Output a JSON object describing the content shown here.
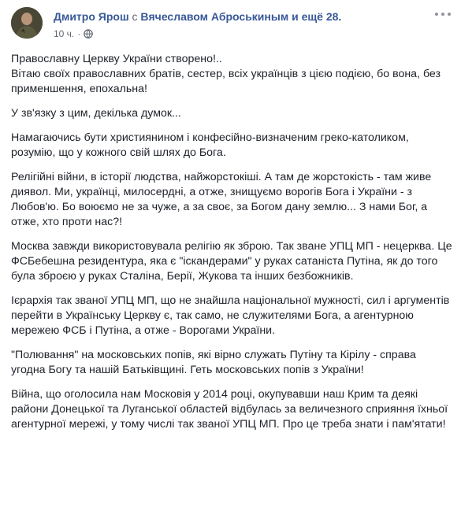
{
  "post": {
    "author": "Дмитро Ярош",
    "with_text": "с",
    "tagged": "Вячеславом Аброськиным и ещё 28.",
    "time": "10 ч.",
    "separator": "·",
    "privacy_icon": "globe-icon",
    "menu_icon": "more-options-icon",
    "paragraphs": [
      "Православну Церкву України створено!..\nВітаю своїх православних братів, сестер, всіх українців з цією подією, бо вона, без применшення, епохальна!",
      "У зв'язку з цим, декілька думок...",
      "Намагаючись бути християнином і конфесійно-визначеним греко-католиком, розумію, що у кожного свій шлях до Бога.",
      "Релігійні війни, в історії людства, найжорстокіші. А там де жорстокість - там живе диявол. Ми, українці, милосердні, а отже, знищуємо ворогів Бога і України - з Любов'ю. Бо воюємо не за чуже, а за своє, за Богом дану землю... З нами Бог, а отже, хто проти нас?!",
      "Москва завжди використовувала релігію як зброю. Так зване УПЦ МП - нецерква. Це ФСБебешна резидентура, яка є \"іскандерами\" у руках сатаніста Путіна, як до того була зброєю у руках Сталіна, Берії, Жукова та інших безбожників.",
      "Ієрархія так званої УПЦ МП, що не знайшла національної мужності, сил і аргументів перейти в Українську Церкву є, так само, не служителями Бога, а агентурною мережею ФСБ і Путіна, а отже - Ворогами України.",
      "\"Полювання\" на московських попів, які вірно служать Путіну та Кірілу - справа угодна Богу та нашій Батьківщині. Геть московських попів з України!",
      "Війна, що оголосила нам Московія у 2014 році, окупувавши наш Крим та деякі райони Донецької та Луганської областей відбулась за величезного сприяння їхньої агентурної мережі, у тому числі так званої УПЦ МП. Про це треба знати і пам'ятати!"
    ]
  },
  "colors": {
    "link": "#385898",
    "text": "#1d2129",
    "meta": "#616770"
  }
}
